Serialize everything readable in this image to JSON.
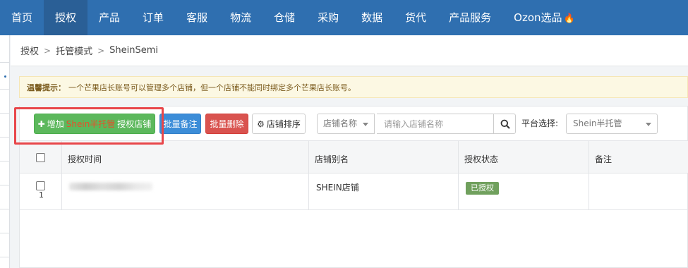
{
  "nav": {
    "items": [
      "首页",
      "授权",
      "产品",
      "订单",
      "客服",
      "物流",
      "仓储",
      "采购",
      "数据",
      "货代",
      "产品服务",
      "Ozon选品"
    ],
    "active_index": 1,
    "hot_icon": "fire-icon"
  },
  "breadcrumb": {
    "items": [
      "授权",
      "托管模式",
      "SheinSemi"
    ],
    "separator": ">"
  },
  "tip": {
    "label": "温馨提示：",
    "text": "一个芒果店长账号可以管理多个店铺，但一个店铺不能同时绑定多个芒果店长账号。"
  },
  "toolbar": {
    "add_prefix": "增加",
    "add_platform": "Shein半托管",
    "add_suffix": "授权店铺",
    "batch_note": "批量备注",
    "batch_delete": "批量删除",
    "sort": "店铺排序",
    "search_field": "店铺名称",
    "search_placeholder": "请输入店铺名称",
    "platform_label": "平台选择:",
    "platform_value": "Shein半托管"
  },
  "table": {
    "headers": [
      "授权时间",
      "店铺别名",
      "授权状态",
      "备注"
    ],
    "rows": [
      {
        "index": "1",
        "store_alias": "SHEIN店铺",
        "status": "已授权",
        "note": ""
      }
    ]
  },
  "colors": {
    "nav_bg": "#2f6fb0",
    "add_button": "#5cb85c",
    "note_button": "#3c8dd8",
    "delete_button": "#d9534f",
    "status_badge": "#70a05d",
    "highlight_box": "#e8464a"
  }
}
